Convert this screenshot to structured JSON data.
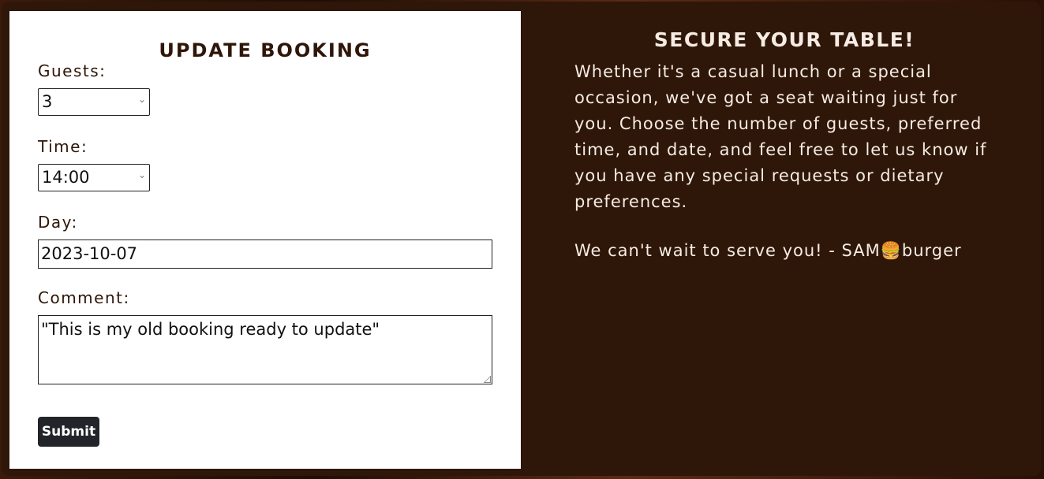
{
  "form": {
    "title": "UPDATE BOOKING",
    "guests": {
      "label": "Guests:",
      "value": "3"
    },
    "time": {
      "label": "Time:",
      "value": "14:00"
    },
    "day": {
      "label": "Day:",
      "value": "2023-10-07"
    },
    "comment": {
      "label": "Comment:",
      "value": "\"This is my old booking ready to update\""
    },
    "submit_label": "Submit"
  },
  "info": {
    "title": "SECURE YOUR TABLE!",
    "text": "Whether it's a casual lunch or a special occasion, we've got a seat waiting just for you. Choose the number of guests, preferred time, and date, and feel free to let us know if you have any special requests or dietary preferences.",
    "sign": "We can't wait to serve you! - SAM🍔burger"
  }
}
